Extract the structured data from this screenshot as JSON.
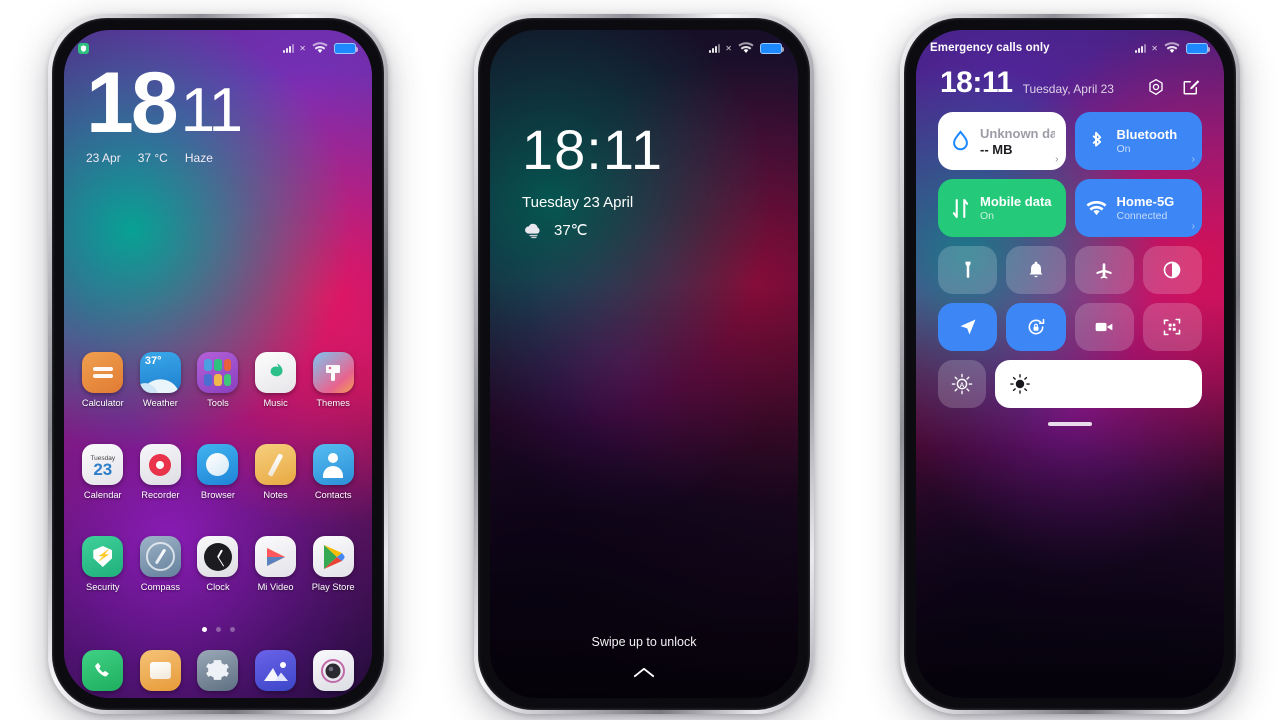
{
  "statusbar": {
    "home_left_icon": "security-shield-icon",
    "signal_icon": "signal-no-service-icon",
    "wifi_icon": "wifi-icon",
    "battery_icon": "battery-icon",
    "carrier_text": "Emergency calls only"
  },
  "home": {
    "clock": {
      "hours": "18",
      "minutes": "11"
    },
    "meta": {
      "date": "23 Apr",
      "temp": "37 °C",
      "condition": "Haze"
    },
    "rows": [
      [
        {
          "label": "Calculator",
          "icon": "calculator-icon"
        },
        {
          "label": "Weather",
          "icon": "weather-icon",
          "badge": "37°"
        },
        {
          "label": "Tools",
          "icon": "tools-folder-icon"
        },
        {
          "label": "Music",
          "icon": "music-icon"
        },
        {
          "label": "Themes",
          "icon": "themes-icon"
        }
      ],
      [
        {
          "label": "Calendar",
          "icon": "calendar-icon",
          "day_name": "Tuesday",
          "day_num": "23"
        },
        {
          "label": "Recorder",
          "icon": "recorder-icon"
        },
        {
          "label": "Browser",
          "icon": "browser-icon"
        },
        {
          "label": "Notes",
          "icon": "notes-icon"
        },
        {
          "label": "Contacts",
          "icon": "contacts-icon"
        }
      ],
      [
        {
          "label": "Security",
          "icon": "security-icon"
        },
        {
          "label": "Compass",
          "icon": "compass-icon"
        },
        {
          "label": "Clock",
          "icon": "clock-icon"
        },
        {
          "label": "Mi Video",
          "icon": "mi-video-icon"
        },
        {
          "label": "Play Store",
          "icon": "play-store-icon"
        }
      ]
    ],
    "page_dots": {
      "count": 3,
      "active": 1
    },
    "dock": [
      {
        "name": "phone-icon"
      },
      {
        "name": "messages-icon"
      },
      {
        "name": "settings-icon"
      },
      {
        "name": "gallery-icon"
      },
      {
        "name": "camera-icon"
      }
    ]
  },
  "lockscreen": {
    "time": "18:11",
    "date": "Tuesday 23 April",
    "weather_icon": "cloud-haze-icon",
    "temperature": "37℃",
    "swipe_hint": "Swipe up to unlock",
    "chevron_icon": "chevron-up-icon"
  },
  "controlcenter": {
    "time": "18:11",
    "date": "Tuesday, April 23",
    "settings_icon": "settings-hex-icon",
    "edit_icon": "edit-icon",
    "tiles": [
      {
        "name": "data-usage-tile",
        "title": "Unknown data plan",
        "subtitle": "-- MB",
        "icon": "data-drop-icon",
        "style": "t-white",
        "arrow": "›"
      },
      {
        "name": "bluetooth-tile",
        "title": "Bluetooth",
        "subtitle": "On",
        "icon": "bluetooth-icon",
        "style": "t-blue",
        "arrow": "›"
      },
      {
        "name": "mobile-data-tile",
        "title": "Mobile data",
        "subtitle": "On",
        "icon": "mobile-data-icon",
        "style": "t-green",
        "arrow": ""
      },
      {
        "name": "wifi-tile",
        "title": "Home-5G",
        "subtitle": "Connected",
        "icon": "wifi-icon",
        "style": "t-blue",
        "arrow": "›"
      }
    ],
    "quick_toggles": [
      {
        "name": "flashlight-toggle",
        "icon": "flashlight-icon",
        "on": false
      },
      {
        "name": "ringtone-toggle",
        "icon": "bell-icon",
        "on": false
      },
      {
        "name": "airplane-mode-toggle",
        "icon": "airplane-icon",
        "on": false
      },
      {
        "name": "dark-mode-toggle",
        "icon": "dark-mode-icon",
        "on": false
      },
      {
        "name": "location-toggle",
        "icon": "location-icon",
        "on": true
      },
      {
        "name": "rotation-lock-toggle",
        "icon": "rotation-lock-icon",
        "on": true
      },
      {
        "name": "screen-recorder-toggle",
        "icon": "video-camera-icon",
        "on": false
      },
      {
        "name": "scanner-toggle",
        "icon": "qr-scan-icon",
        "on": false
      }
    ],
    "brightness": {
      "auto_button_icon": "auto-brightness-icon",
      "slider_icon": "brightness-icon",
      "value_percent": 100
    },
    "handle_icon": "drag-handle"
  },
  "colors": {
    "accent_blue": "#3d86f5",
    "accent_green": "#25c97a",
    "battery_blue": "#1e88ff",
    "tile_white": "#ffffff"
  }
}
